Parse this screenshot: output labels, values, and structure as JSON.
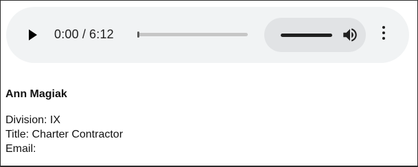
{
  "player": {
    "current_time": "0:00",
    "separator": "/",
    "duration": "6:12",
    "progress_fraction": 0.0,
    "volume_fraction": 1.0,
    "icons": {
      "play": "play-icon",
      "volume": "volume-icon",
      "menu": "more-vert-icon"
    }
  },
  "contact": {
    "name": "Ann Magiak",
    "division": "Division: IX",
    "title": "Title: Charter Contractor",
    "email": "Email:"
  }
}
